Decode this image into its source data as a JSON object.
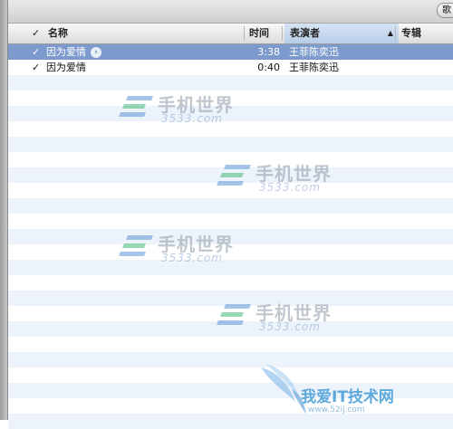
{
  "topbar": {
    "button_label": "歌"
  },
  "columns": {
    "check": "✓",
    "name": "名称",
    "time": "时间",
    "artist": "表演者",
    "album": "专辑"
  },
  "songs": [
    {
      "checked": "✓",
      "name": "因为爱情",
      "time": "3:38",
      "artist": "王菲陈奕迅",
      "selected": true
    },
    {
      "checked": "✓",
      "name": "因为爱情",
      "time": "0:40",
      "artist": "王菲陈奕迅",
      "selected": false
    }
  ],
  "watermark": {
    "brand": "手机世界",
    "domain": "3533.com",
    "bottom_brand": "我爱IT技术网",
    "bottom_url": "www.52ij.com"
  },
  "colors": {
    "selected_row": "#7c9acc",
    "alt_row": "#edf3fb"
  }
}
